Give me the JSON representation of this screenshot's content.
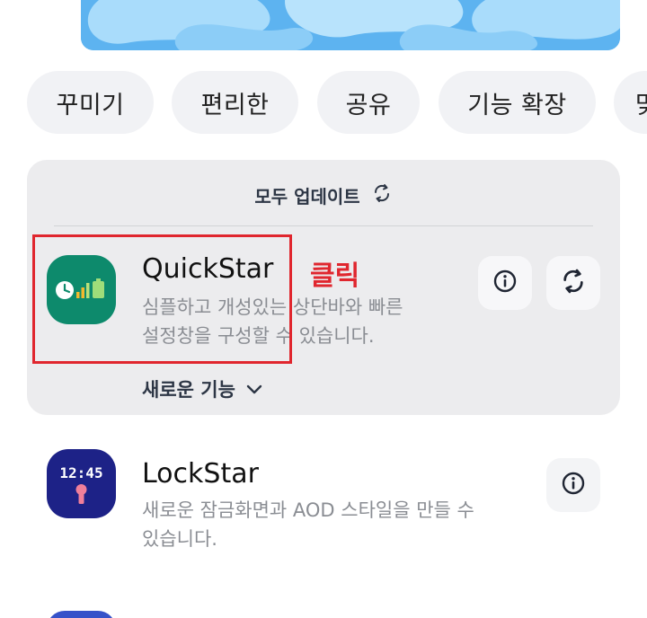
{
  "chips": [
    {
      "label": "꾸미기"
    },
    {
      "label": "편리한"
    },
    {
      "label": "공유"
    },
    {
      "label": "기능 확장"
    },
    {
      "label": "맞"
    }
  ],
  "update_card": {
    "update_all_label": "모두 업데이트",
    "app": {
      "name": "QuickStar",
      "description": "심플하고 개성있는 상단바와 빠른\n설정창을 구성할 수 있습니다.",
      "new_features_label": "새로운 기능"
    }
  },
  "annotation": {
    "click_label": "클릭",
    "color": "#e0262e"
  },
  "apps": [
    {
      "name": "LockStar",
      "description": "새로운 잠금화면과 AOD 스타일을 만들 수\n있습니다.",
      "icon_text": "12:45"
    }
  ],
  "colors": {
    "quickstar_icon": "#0d8a6c",
    "lockstar_icon": "#1d2287",
    "chip_bg": "#f1f2f5",
    "card_bg": "#ececee"
  },
  "icons": {
    "refresh": "refresh-icon",
    "info": "info-icon",
    "chevron": "chevron-down-icon"
  }
}
